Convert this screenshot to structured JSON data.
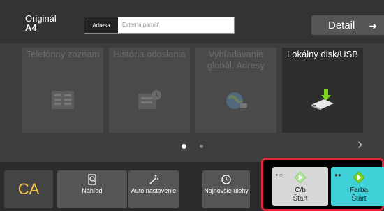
{
  "header": {
    "original_label": "Originál",
    "original_size": "A4",
    "address_tag": "Adresa",
    "address_placeholder": "Externá pamäť",
    "detail_label": "Detail"
  },
  "tiles": [
    {
      "label": "Telefónny zoznam",
      "icon": "address-book-icon",
      "active": false
    },
    {
      "label": "História odoslania",
      "icon": "history-icon",
      "active": false
    },
    {
      "label": "Vyhľadávanie globál. Adresy",
      "icon": "global-search-icon",
      "active": false
    },
    {
      "label": "Lokálny disk/USB",
      "icon": "usb-drive-icon",
      "active": true
    }
  ],
  "pager": {
    "current": 1,
    "total": 2
  },
  "bottom": {
    "ca_label": "CA",
    "preview_label": "Náhľad",
    "auto_label": "Auto nastavenie",
    "jobs_label": "Najnovšie úlohy",
    "bw_start_label_1": "C/b",
    "bw_start_label_2": "Štart",
    "color_start_label_1": "Farba",
    "color_start_label_2": "Štart"
  },
  "colors": {
    "ca": "#f4c24a",
    "highlight_frame": "#e0283a",
    "color_start": "#3fd0d8",
    "bw_start": "#d8d8d8",
    "usb_arrow": "#7ed321"
  }
}
